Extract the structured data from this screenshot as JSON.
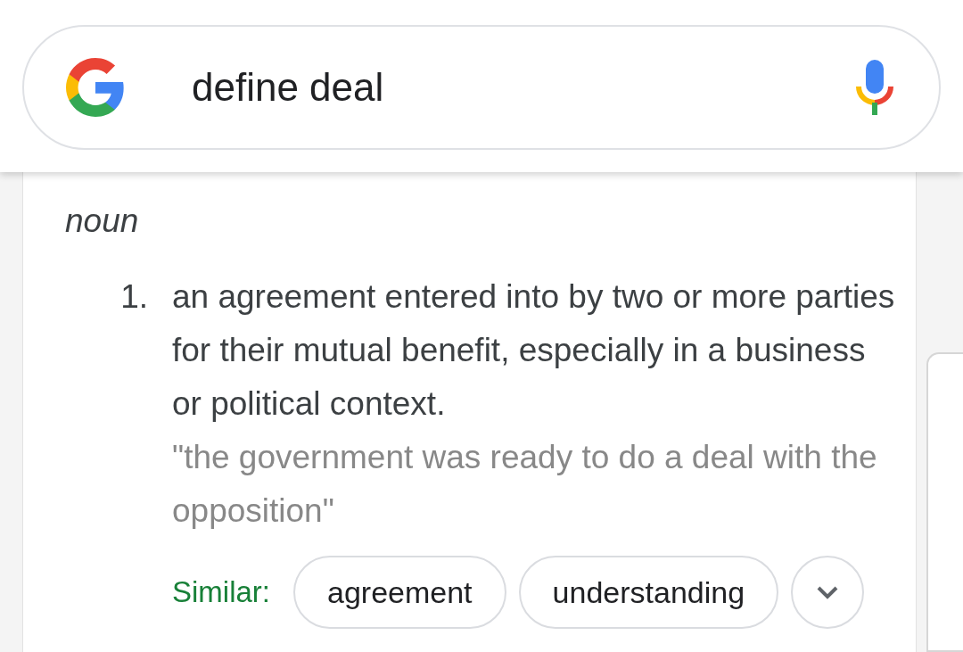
{
  "search": {
    "query": "define deal"
  },
  "entry": {
    "part_of_speech": "noun",
    "senses": [
      {
        "number": "1.",
        "definition": "an agreement entered into by two or more parties for their mutual benefit, especially in a business or political context.",
        "example": "\"the government was ready to do a deal with the opposition\""
      }
    ],
    "similar": {
      "label": "Similar:",
      "words": [
        "agreement",
        "understanding"
      ]
    }
  }
}
